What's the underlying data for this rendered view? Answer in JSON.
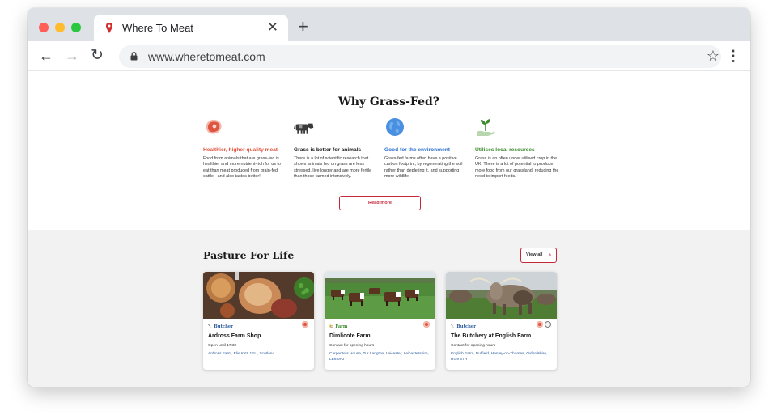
{
  "browser": {
    "tab_title": "Where To Meat",
    "close_glyph": "✕",
    "newtab_glyph": "+",
    "back_glyph": "←",
    "forward_glyph": "→",
    "reload_glyph": "↻",
    "url": "www.wheretomeat.com",
    "star_glyph": "☆",
    "menu_glyph": "⋮"
  },
  "why": {
    "title": "Why Grass-Fed?",
    "features": [
      {
        "title": "Healthier, higher quality meat",
        "color": "#e0533e",
        "icon": "steak-icon",
        "text": "Food from animals that are grass-fed is healthier and more nutrient-rich for us to eat than meat produced from grain-fed cattle - and also tastes better!"
      },
      {
        "title": "Grass is better for animals",
        "color": "#1a1a1a",
        "icon": "cow-icon",
        "text": "There is a lot of scientific research that shows animals fed on grass are less stressed, live longer and are more fertile than those farmed intensively."
      },
      {
        "title": "Good for the environment",
        "color": "#2c6fcf",
        "icon": "globe-icon",
        "text": "Grass-fed farms often have a positive carbon footprint, by regenerating the soil rather than depleting it, and supporting more wildlife."
      },
      {
        "title": "Utilises local resources",
        "color": "#3c8a2e",
        "icon": "sprout-hand-icon",
        "text": "Grass is an often under utilised crop in the UK. There is a lot of potential to produce more food from our grassland, reducing the need to import feeds."
      }
    ],
    "read_more": "Read more"
  },
  "pasture": {
    "title": "Pasture For Life",
    "view_all": "View all",
    "view_all_arrow": "›",
    "cards": [
      {
        "type": "Butcher",
        "type_color": "#2a5a9a",
        "type_glyph": "🔪",
        "name": "Ardross Farm Shop",
        "hours": "Open until 17:30",
        "address": "Ardross Farm, Elie KY9 1EU, Scotland",
        "photo": "meat-platter"
      },
      {
        "type": "Farm",
        "type_color": "#3c8a2e",
        "type_glyph": "🏡",
        "name": "Dimlicote Farm",
        "hours": "Contact for opening hours",
        "address": "Carpenters House, Tur Langton, Leicester, Leicestershire, LE8 0PJ",
        "photo": "cattle-field"
      },
      {
        "type": "Butcher",
        "type_color": "#2a5a9a",
        "type_glyph": "🔪",
        "name": "The Butchery at English Farm",
        "hours": "Contact for opening hours",
        "address": "English Farm, Nuffield, Henley-on-Thames, Oxfordshire, RG9 5TH",
        "photo": "longhorn-cattle"
      }
    ]
  }
}
